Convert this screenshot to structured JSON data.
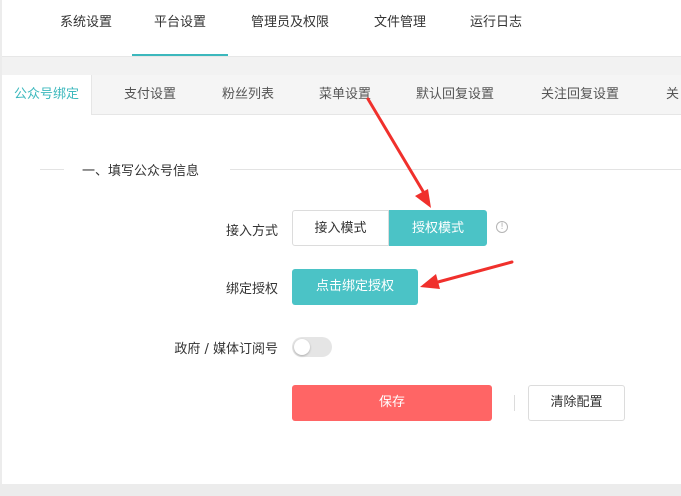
{
  "top_nav": {
    "tabs": [
      {
        "label": "系统设置"
      },
      {
        "label": "平台设置"
      },
      {
        "label": "管理员及权限"
      },
      {
        "label": "文件管理"
      },
      {
        "label": "运行日志"
      }
    ],
    "active": "平台设置"
  },
  "sub_nav": {
    "tabs": [
      {
        "label": "公众号绑定"
      },
      {
        "label": "支付设置"
      },
      {
        "label": "粉丝列表"
      },
      {
        "label": "菜单设置"
      },
      {
        "label": "默认回复设置"
      },
      {
        "label": "关注回复设置"
      },
      {
        "label": "关"
      }
    ],
    "active": "公众号绑定"
  },
  "section": {
    "title": "一、填写公众号信息"
  },
  "form": {
    "access_mode": {
      "label": "接入方式",
      "options": [
        "接入模式",
        "授权模式"
      ],
      "selected": "授权模式",
      "info_icon": "!"
    },
    "bind_auth": {
      "label": "绑定授权",
      "button": "点击绑定授权"
    },
    "gov_media": {
      "label": "政府 / 媒体订阅号",
      "enabled": false
    }
  },
  "actions": {
    "save": "保存",
    "clear": "清除配置"
  },
  "colors": {
    "accent": "#4bc3c6",
    "danger": "#ff6565",
    "annotation": "#f0302c"
  }
}
